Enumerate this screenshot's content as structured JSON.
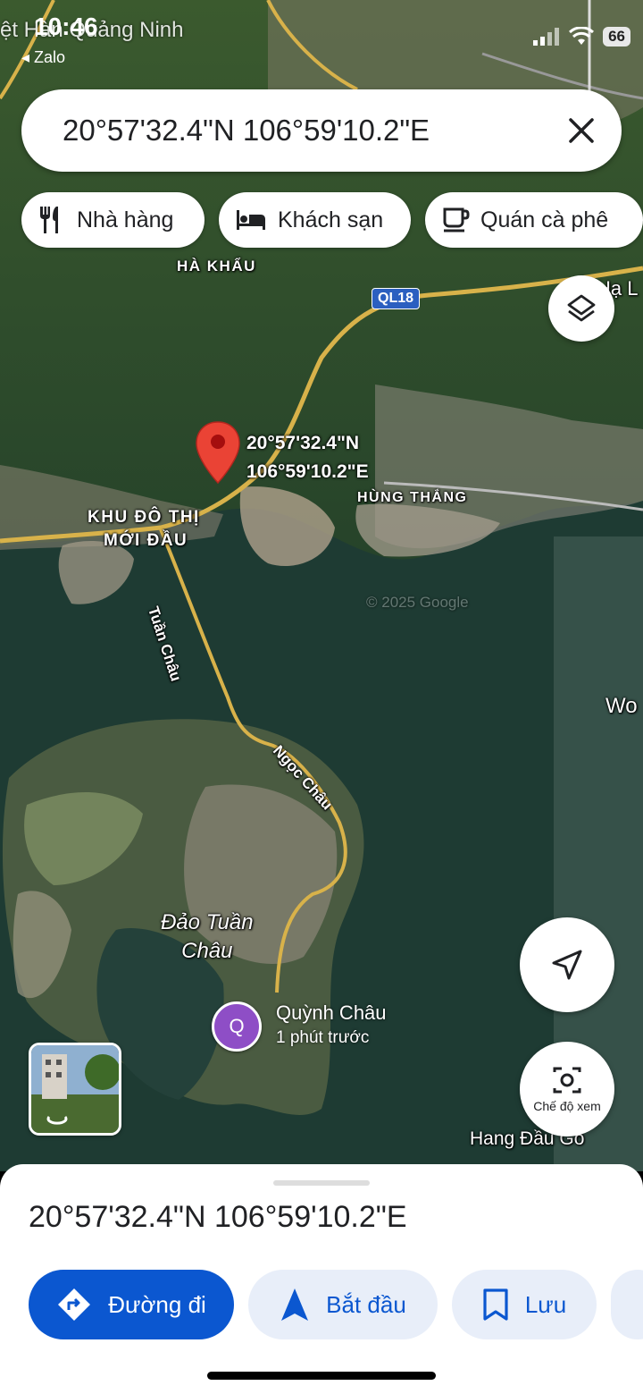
{
  "status_bar": {
    "time": "10:46",
    "back_app": "◂ Zalo",
    "battery": "66",
    "background_text": "ệt Hàn Quảng Ninh"
  },
  "search": {
    "query": "20°57'32.4\"N 106°59'10.2\"E",
    "close_icon": "close-icon"
  },
  "chips": [
    {
      "label": "Nhà hàng",
      "icon": "restaurant-icon"
    },
    {
      "label": "Khách sạn",
      "icon": "hotel-icon"
    },
    {
      "label": "Quán cà phê",
      "icon": "coffee-icon"
    }
  ],
  "map": {
    "labels": {
      "ha_khau": "HÀ KHẨU",
      "road": "QL18",
      "hung_thang": "HÙNG THẮNG",
      "khu_do_thi_1": "KHU ĐÔ THỊ",
      "khu_do_thi_2": "MỚI ĐẦU",
      "tuan_chau_road": "Tuần Châu",
      "ngoc_chau_road": "Ngọc Châu",
      "dao_1": "Đảo Tuần",
      "dao_2": "Châu",
      "hang_dau_go": "Hang Đầu Gỗ",
      "wo": "Wo",
      "ha_l": "Hạ L",
      "copyright": "© 2025 Google"
    },
    "pin": {
      "line1": "20°57'32.4\"N",
      "line2": "106°59'10.2\"E",
      "color": "#ea4335"
    },
    "friend": {
      "initial": "Q",
      "name": "Quỳnh Châu",
      "time": "1 phút trước",
      "color": "#8e4ec6"
    },
    "view_mode_label": "Chế độ xem"
  },
  "sheet": {
    "coordinates": "20°57'32.4\"N 106°59'10.2\"E",
    "actions": [
      {
        "label": "Đường đi",
        "icon": "directions-icon"
      },
      {
        "label": "Bắt đầu",
        "icon": "navigation-arrow-icon"
      },
      {
        "label": "Lưu",
        "icon": "bookmark-icon"
      }
    ],
    "accent": "#0b57d0"
  }
}
